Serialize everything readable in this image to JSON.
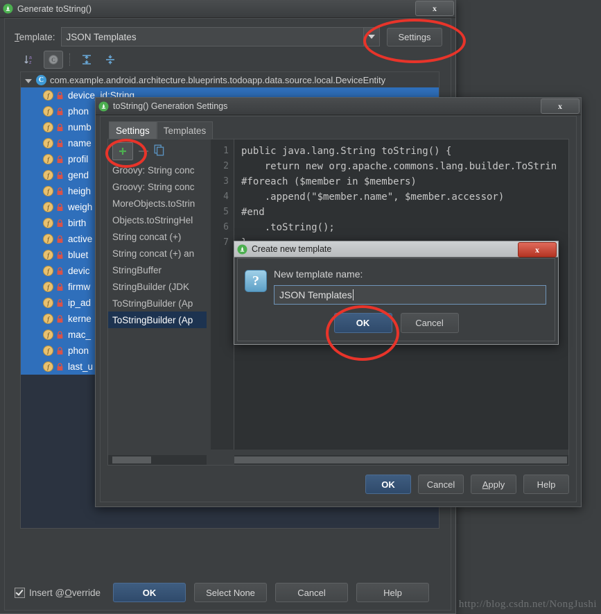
{
  "colors": {
    "accent_red": "#e8342a",
    "dialog_bg": "#3c3f41",
    "tree_bg": "#2b3340",
    "selection_blue": "#2f6fbb",
    "primary_button": "#3f5d80"
  },
  "generate_dialog": {
    "title": "Generate toString()",
    "close_label": "x",
    "template_label": "Template:",
    "template_value": "JSON Templates",
    "settings_button": "Settings",
    "toolbar": [
      {
        "name": "sort-alphabetically-icon",
        "tooltip": "Sort alphabetically",
        "selected": false
      },
      {
        "name": "group-by-class-icon",
        "tooltip": "Group by class",
        "selected": true
      },
      {
        "name": "expand-all-icon",
        "tooltip": "Expand all",
        "selected": false
      },
      {
        "name": "collapse-all-icon",
        "tooltip": "Collapse all",
        "selected": false
      }
    ],
    "class_node": "com.example.android.architecture.blueprints.todoapp.data.source.local.DeviceEntity",
    "fields": [
      {
        "label": "device_id:String",
        "selected": true
      },
      {
        "label": "phon",
        "selected": true
      },
      {
        "label": "numb",
        "selected": true
      },
      {
        "label": "name",
        "selected": true
      },
      {
        "label": "profil",
        "selected": true
      },
      {
        "label": "gend",
        "selected": true
      },
      {
        "label": "heigh",
        "selected": true
      },
      {
        "label": "weigh",
        "selected": true
      },
      {
        "label": "birth",
        "selected": true
      },
      {
        "label": "active",
        "selected": true
      },
      {
        "label": "bluet",
        "selected": true
      },
      {
        "label": "devic",
        "selected": true
      },
      {
        "label": "firmw",
        "selected": true
      },
      {
        "label": "ip_ad",
        "selected": true
      },
      {
        "label": "kerne",
        "selected": true
      },
      {
        "label": "mac_",
        "selected": true
      },
      {
        "label": "phon",
        "selected": true
      },
      {
        "label": "last_u",
        "selected": true
      }
    ],
    "insert_override_label": "Insert @Override",
    "insert_override_checked": true,
    "buttons": {
      "ok": "OK",
      "select_none": "Select None",
      "cancel": "Cancel",
      "help": "Help"
    }
  },
  "settings_dialog": {
    "title": "toString() Generation Settings",
    "close_label": "x",
    "tabs": [
      {
        "label": "Settings",
        "active": true
      },
      {
        "label": "Templates",
        "active": false
      }
    ],
    "list_toolbar": {
      "add": "+",
      "remove": "-",
      "copy_icon": "copy-icon"
    },
    "templates": [
      {
        "label": "Groovy: String conc",
        "selected": false
      },
      {
        "label": "Groovy: String conc",
        "selected": false
      },
      {
        "label": "MoreObjects.toStrin",
        "selected": false
      },
      {
        "label": "Objects.toStringHel",
        "selected": false
      },
      {
        "label": "String concat (+)",
        "selected": false
      },
      {
        "label": "String concat (+) an",
        "selected": false
      },
      {
        "label": "StringBuffer",
        "selected": false
      },
      {
        "label": "StringBuilder (JDK ",
        "selected": false
      },
      {
        "label": "ToStringBuilder (Ap",
        "selected": false
      },
      {
        "label": "ToStringBuilder (Ap",
        "selected": true
      }
    ],
    "editor": {
      "line_numbers": [
        "1",
        "2",
        "3",
        "4",
        "5",
        "6",
        "7"
      ],
      "lines": [
        "public java.lang.String toString() {",
        "    return new org.apache.commons.lang.builder.ToStrin",
        "#foreach ($member in $members)",
        "    .append(\"$member.name\", $member.accessor)",
        "#end",
        "    .toString();",
        "}"
      ]
    },
    "buttons": {
      "ok": "OK",
      "cancel": "Cancel",
      "apply": "Apply",
      "help": "Help"
    }
  },
  "create_template_dialog": {
    "title": "Create new template",
    "close_label": "x",
    "question_icon": "?",
    "field_label": "New template name:",
    "field_value": "JSON Templates",
    "field_placeholder": "",
    "buttons": {
      "ok": "OK",
      "cancel": "Cancel"
    }
  },
  "watermark": "http://blog.csdn.net/NongJushi"
}
